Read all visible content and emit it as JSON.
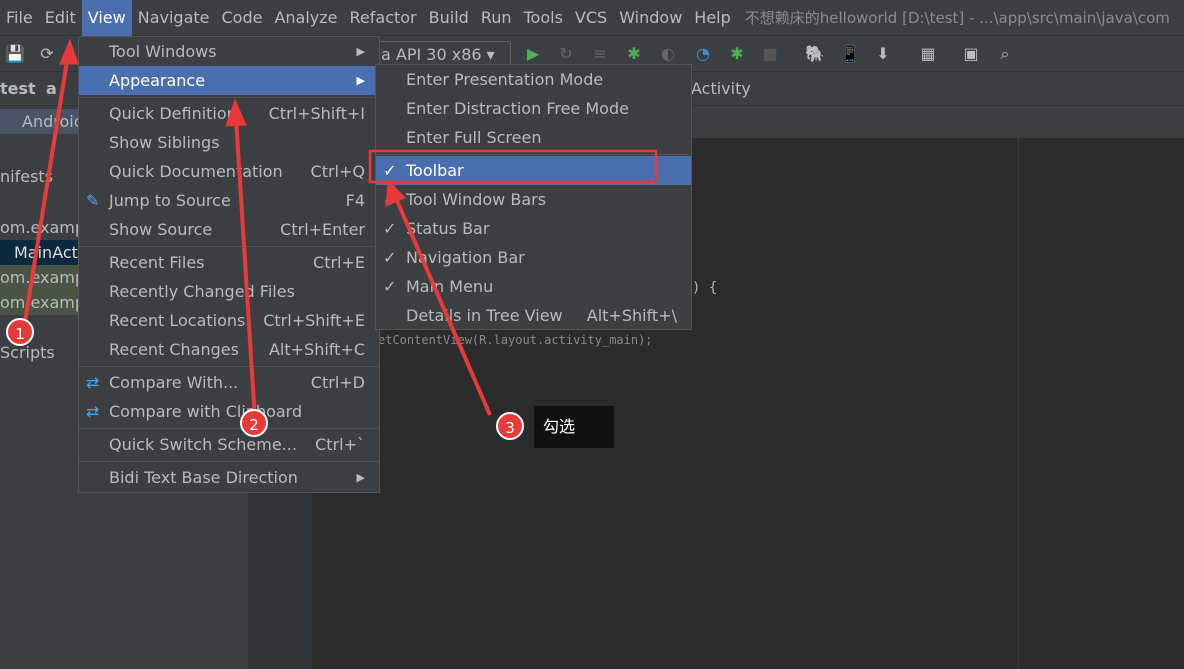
{
  "menubar": {
    "items": [
      "File",
      "Edit",
      "View",
      "Navigate",
      "Code",
      "Analyze",
      "Refactor",
      "Build",
      "Run",
      "Tools",
      "VCS",
      "Window",
      "Help"
    ],
    "active": "View",
    "title": "不想赖床的helloworld [D:\\test] - ...\\app\\src\\main\\java\\com"
  },
  "toolbar": {
    "device": "a API 30 x86"
  },
  "navbar": {
    "crumbs": [
      "test",
      "a"
    ],
    "tab": "Activity"
  },
  "left": {
    "items": [
      "Androic",
      "nifests",
      "om.examp",
      "MainAct",
      "om.examp",
      "om.examp",
      "Scripts"
    ]
  },
  "editor": {
    "line1": ") {",
    "line2": "etContentView(R.layout.activity_main);"
  },
  "view_menu": {
    "items": [
      {
        "label": "Tool Windows",
        "shortcut": "",
        "submenu": true
      },
      {
        "label": "Appearance",
        "shortcut": "",
        "submenu": true
      },
      {
        "label": "Quick Definition",
        "shortcut": "Ctrl+Shift+I"
      },
      {
        "label": "Show Siblings",
        "shortcut": ""
      },
      {
        "label": "Quick Documentation",
        "shortcut": "Ctrl+Q"
      },
      {
        "label": "Jump to Source",
        "shortcut": "F4",
        "icon": "pencil-icon"
      },
      {
        "label": "Show Source",
        "shortcut": "Ctrl+Enter"
      },
      {
        "label": "Recent Files",
        "shortcut": "Ctrl+E"
      },
      {
        "label": "Recently Changed Files",
        "shortcut": ""
      },
      {
        "label": "Recent Locations",
        "shortcut": "Ctrl+Shift+E"
      },
      {
        "label": "Recent Changes",
        "shortcut": "Alt+Shift+C"
      },
      {
        "label": "Compare With...",
        "shortcut": "Ctrl+D",
        "icon": "compare-icon"
      },
      {
        "label": "Compare with Clipboard",
        "shortcut": "",
        "icon": "clipboard-compare-icon"
      },
      {
        "label": "Quick Switch Scheme...",
        "shortcut": "Ctrl+`"
      },
      {
        "label": "Bidi Text Base Direction",
        "shortcut": "",
        "submenu": true
      }
    ]
  },
  "appearance_menu": {
    "items": [
      {
        "label": "Enter Presentation Mode",
        "checked": false,
        "shortcut": ""
      },
      {
        "label": "Enter Distraction Free Mode",
        "checked": false,
        "shortcut": ""
      },
      {
        "label": "Enter Full Screen",
        "checked": false,
        "shortcut": ""
      },
      {
        "label": "Toolbar",
        "checked": true,
        "shortcut": ""
      },
      {
        "label": "Tool Window Bars",
        "checked": true,
        "shortcut": ""
      },
      {
        "label": "Status Bar",
        "checked": true,
        "shortcut": ""
      },
      {
        "label": "Navigation Bar",
        "checked": true,
        "shortcut": ""
      },
      {
        "label": "Main Menu",
        "checked": true,
        "shortcut": ""
      },
      {
        "label": "Details in Tree View",
        "checked": false,
        "shortcut": "Alt+Shift+\\"
      }
    ]
  },
  "annotations": {
    "badges": [
      "1",
      "2",
      "3"
    ],
    "callout": "勾选",
    "color": "#e83a3a"
  },
  "colors": {
    "highlight": "#4b6eaf",
    "menu_bg": "#3c3f41",
    "editor_bg": "#2b2b2b"
  }
}
